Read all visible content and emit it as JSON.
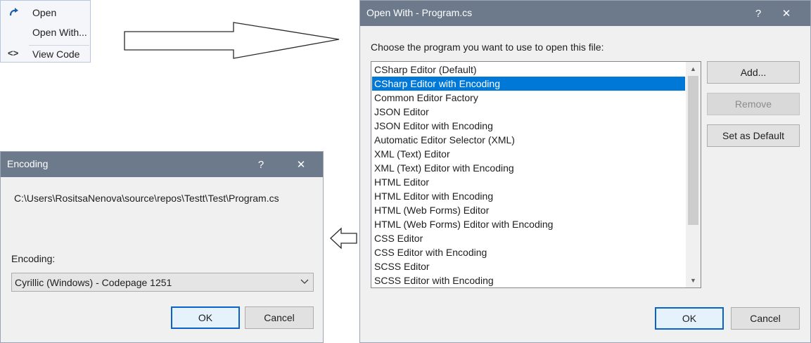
{
  "context_menu": {
    "items": [
      {
        "label": "Open",
        "icon": "redo-arrow-icon"
      },
      {
        "label": "Open With...",
        "icon": ""
      },
      {
        "label": "View Code",
        "icon": "code-brackets-icon"
      }
    ]
  },
  "open_with_dialog": {
    "title": "Open With - Program.cs",
    "help_glyph": "?",
    "close_glyph": "✕",
    "prompt": "Choose the program you want to use to open this file:",
    "programs": [
      "CSharp Editor (Default)",
      "CSharp Editor with Encoding",
      "Common Editor Factory",
      "JSON Editor",
      "JSON Editor with Encoding",
      "Automatic Editor Selector (XML)",
      "XML (Text) Editor",
      "XML (Text) Editor with Encoding",
      "HTML Editor",
      "HTML Editor with Encoding",
      "HTML (Web Forms) Editor",
      "HTML (Web Forms) Editor with Encoding",
      "CSS Editor",
      "CSS Editor with Encoding",
      "SCSS Editor",
      "SCSS Editor with Encoding"
    ],
    "selected_program": "CSharp Editor with Encoding",
    "add_label": "Add...",
    "remove_label": "Remove",
    "set_default_label": "Set as Default",
    "ok_label": "OK",
    "cancel_label": "Cancel"
  },
  "encoding_dialog": {
    "title": "Encoding",
    "help_glyph": "?",
    "close_glyph": "✕",
    "file_path": "C:\\Users\\RositsaNenova\\source\\repos\\Testt\\Test\\Program.cs",
    "encoding_label": "Encoding:",
    "encoding_value": "Cyrillic (Windows) - Codepage 1251",
    "ok_label": "OK",
    "cancel_label": "Cancel"
  },
  "colors": {
    "titlebar": "#6c7a8c",
    "selection": "#0078d7",
    "dialog_bg": "#f0f0f0",
    "primary_border": "#0a64c8"
  }
}
